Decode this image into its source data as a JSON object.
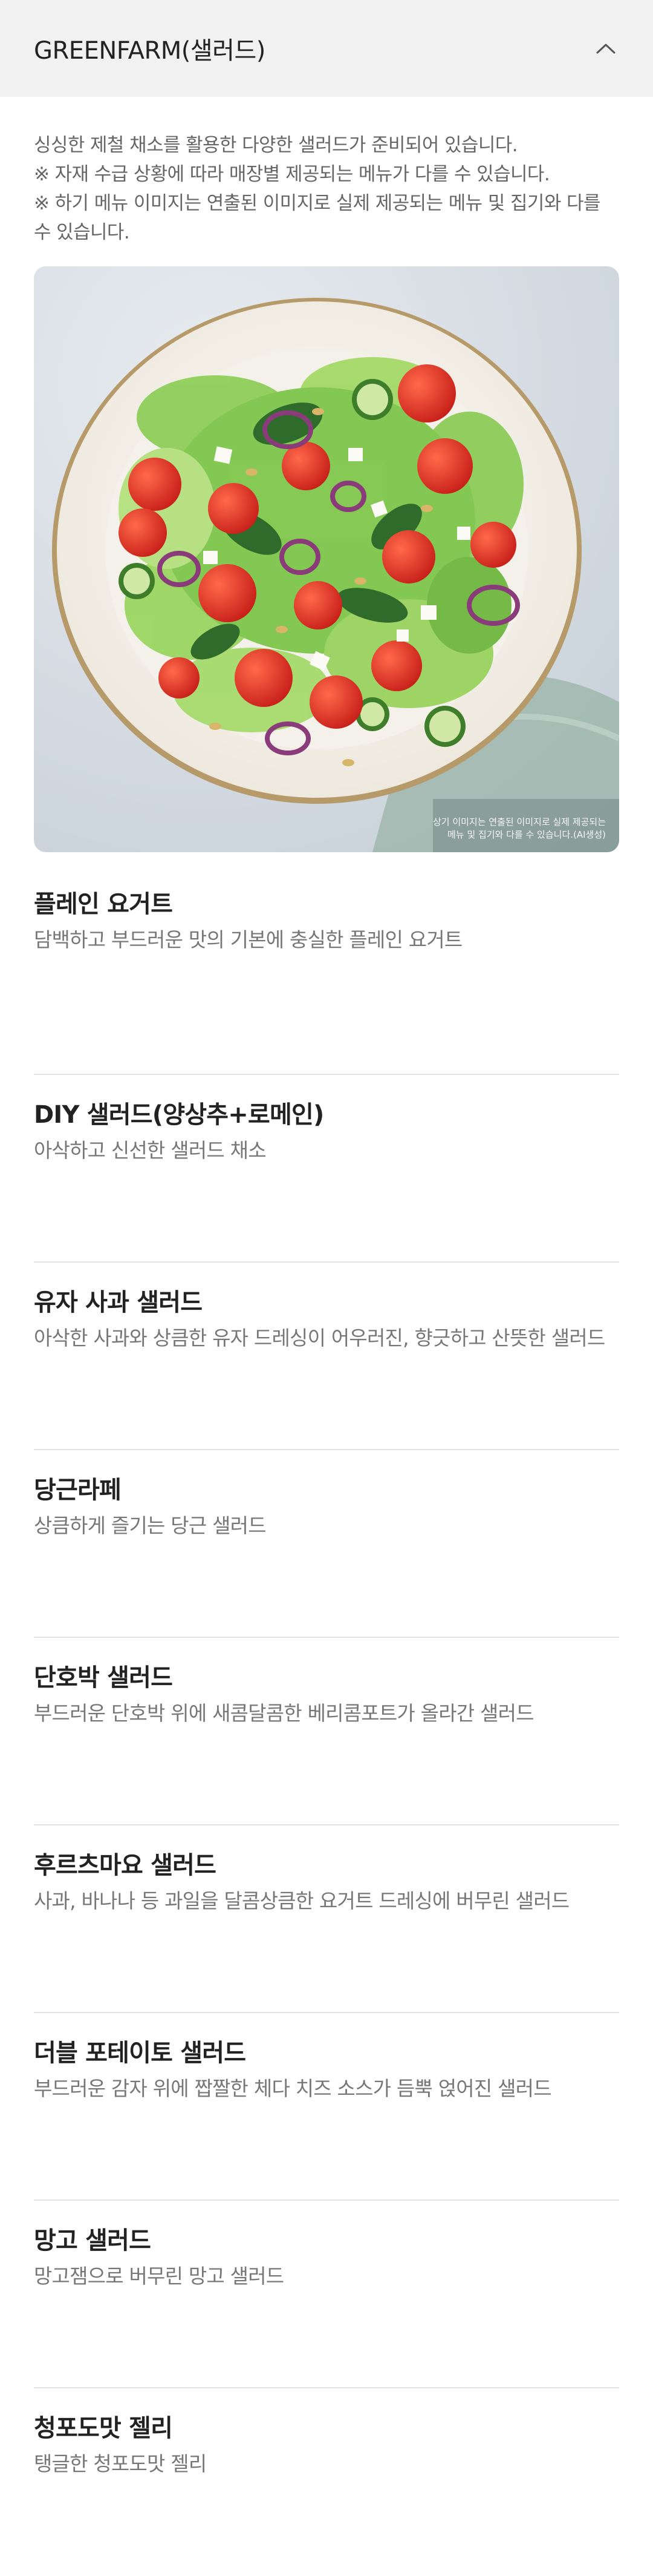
{
  "header": {
    "title": "GREENFARM(샐러드)",
    "toggle_icon": "chevron-up-icon"
  },
  "intro": {
    "line1": "싱싱한 제철 채소를 활용한 다양한 샐러드가 준비되어 있습니다.",
    "line2": "※ 자재 수급 상황에 따라 매장별 제공되는 메뉴가 다를 수 있습니다.",
    "line3": "※ 하기 메뉴 이미지는 연출된 이미지로 실제 제공되는 메뉴 및 집기와 다를 수 있습니다."
  },
  "hero": {
    "caption_line1": "상기 이미지는 연출된 이미지로 실제 제공되는",
    "caption_line2": "메뉴 및 집기와 다를 수 있습니다.(AI생성)"
  },
  "menu": [
    {
      "name": "플레인 요거트",
      "desc": "담백하고 부드러운 맛의 기본에 충실한 플레인 요거트"
    },
    {
      "name": "DIY 샐러드(양상추+로메인)",
      "desc": "아삭하고 신선한 샐러드 채소"
    },
    {
      "name": "유자 사과 샐러드",
      "desc": "아삭한 사과와 상큼한 유자 드레싱이 어우러진, 향긋하고 산뜻한 샐러드"
    },
    {
      "name": "당근라페",
      "desc": "상큼하게 즐기는 당근 샐러드"
    },
    {
      "name": "단호박 샐러드",
      "desc": "부드러운 단호박 위에 새콤달콤한 베리콤포트가 올라간 샐러드"
    },
    {
      "name": "후르츠마요 샐러드",
      "desc": "사과, 바나나 등 과일을 달콤상큼한 요거트 드레싱에 버무린 샐러드"
    },
    {
      "name": "더블 포테이토 샐러드",
      "desc": "부드러운 감자 위에 짭짤한 체다 치즈 소스가 듬뿍 얹어진 샐러드"
    },
    {
      "name": "망고 샐러드",
      "desc": "망고잼으로 버무린 망고 샐러드"
    },
    {
      "name": "청포도맛 젤리",
      "desc": "탱글한 청포도맛 젤리"
    }
  ]
}
